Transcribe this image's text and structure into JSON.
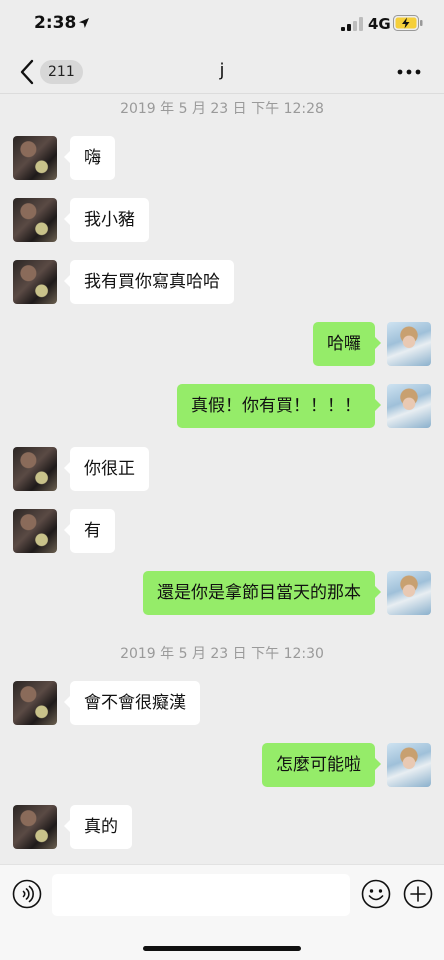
{
  "status_bar": {
    "time": "2:38",
    "network": "4G",
    "icons": [
      "location-arrow-icon",
      "signal-icon",
      "battery-charging-icon"
    ]
  },
  "nav": {
    "back_icon": "chevron-left-icon",
    "unread_count": "211",
    "title": "j",
    "more_icon": "more-dots-icon"
  },
  "messages": [
    {
      "type": "timestamp",
      "text": "2019 年 5 月 23 日  下午 12:28"
    },
    {
      "type": "message",
      "side": "left",
      "text": "嗨"
    },
    {
      "type": "message",
      "side": "left",
      "text": "我小豬"
    },
    {
      "type": "message",
      "side": "left",
      "text": "我有買你寫真哈哈"
    },
    {
      "type": "message",
      "side": "right",
      "text": "哈囉"
    },
    {
      "type": "message",
      "side": "right",
      "text": "真假！你有買！！！！"
    },
    {
      "type": "message",
      "side": "left",
      "text": "你很正"
    },
    {
      "type": "message",
      "side": "left",
      "text": "有"
    },
    {
      "type": "message",
      "side": "right",
      "text": "還是你是拿節目當天的那本"
    },
    {
      "type": "timestamp",
      "text": "2019 年 5 月 23 日  下午 12:30"
    },
    {
      "type": "message",
      "side": "left",
      "text": "會不會很癡漢"
    },
    {
      "type": "message",
      "side": "right",
      "text": "怎麼可能啦"
    },
    {
      "type": "message",
      "side": "left",
      "text": "真的"
    }
  ],
  "input_bar": {
    "voice_icon": "voice-icon",
    "input_value": "",
    "emoji_icon": "emoji-icon",
    "plus_icon": "plus-icon"
  },
  "colors": {
    "background": "#ededed",
    "incoming_bubble": "#ffffff",
    "outgoing_bubble": "#95ec69",
    "timestamp_text": "#9a9a9a"
  }
}
